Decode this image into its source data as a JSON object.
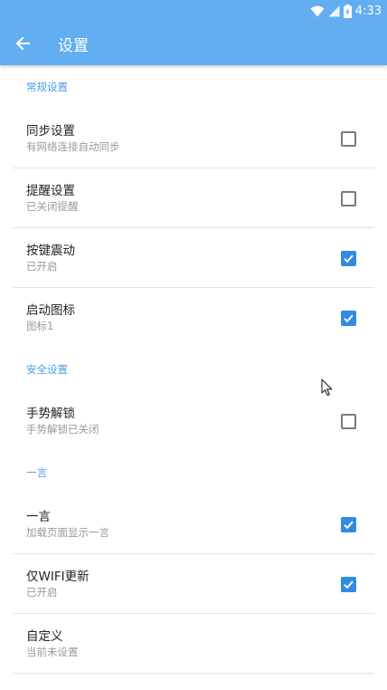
{
  "status_bar": {
    "time": "4:33",
    "icons": [
      "wifi-icon",
      "signal-icon",
      "battery-charging-icon"
    ]
  },
  "app_bar": {
    "back_icon": "arrow-left-icon",
    "title": "设置"
  },
  "sections": [
    {
      "header": "常规设置",
      "items": [
        {
          "title": "同步设置",
          "subtitle": "有网络连接自动同步",
          "checked": false
        },
        {
          "title": "提醒设置",
          "subtitle": "已关闭提醒",
          "checked": false
        },
        {
          "title": "按键震动",
          "subtitle": "已开启",
          "checked": true
        },
        {
          "title": "启动图标",
          "subtitle": "图标1",
          "checked": true
        }
      ]
    },
    {
      "header": "安全设置",
      "items": [
        {
          "title": "手势解锁",
          "subtitle": "手势解锁已关闭",
          "checked": false
        }
      ]
    },
    {
      "header": "一言",
      "items": [
        {
          "title": "一言",
          "subtitle": "加载页面显示一言",
          "checked": true
        },
        {
          "title": "仅WIFI更新",
          "subtitle": "已开启",
          "checked": true
        },
        {
          "title": "自定义",
          "subtitle": "当前未设置"
        }
      ]
    }
  ],
  "colors": {
    "primary": "#62aef0",
    "accent": "#2f8be5",
    "section_header": "#4a9ce8"
  }
}
